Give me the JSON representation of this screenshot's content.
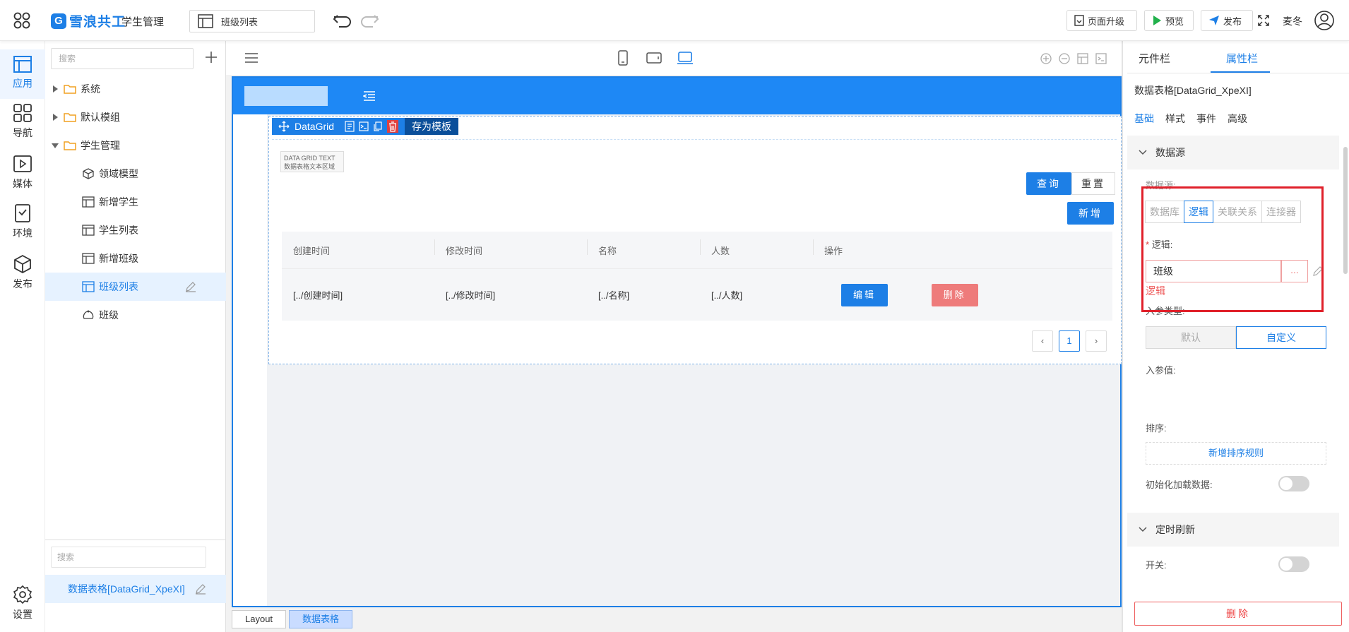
{
  "header": {
    "brand": "雪浪共工",
    "app_name": "学生管理",
    "page_selector": "班级列表",
    "buttons": {
      "upgrade": "页面升级",
      "preview": "预览",
      "publish": "发布"
    },
    "user": "麦冬"
  },
  "rail": [
    {
      "label": "应用",
      "active": true
    },
    {
      "label": "导航"
    },
    {
      "label": "媒体"
    },
    {
      "label": "环境"
    },
    {
      "label": "发布"
    },
    {
      "label": "设置"
    }
  ],
  "tree": {
    "search_placeholder": "搜索",
    "items": [
      {
        "label": "系统",
        "type": "folder"
      },
      {
        "label": "默认模组",
        "type": "folder"
      },
      {
        "label": "学生管理",
        "type": "folder",
        "expanded": true
      },
      {
        "label": "领域模型",
        "type": "model"
      },
      {
        "label": "新增学生",
        "type": "page"
      },
      {
        "label": "学生列表",
        "type": "page"
      },
      {
        "label": "新增班级",
        "type": "page"
      },
      {
        "label": "班级列表",
        "type": "page",
        "selected": true
      },
      {
        "label": "班级",
        "type": "logic"
      }
    ],
    "component_search_placeholder": "搜索",
    "component_selected": "数据表格[DataGrid_XpeXI]"
  },
  "canvas": {
    "datagrid_bar": {
      "name": "DataGrid",
      "save_template": "存为模板"
    },
    "datagrid_text_line1": "DATA GRID TEXT",
    "datagrid_text_line2": "数据表格文本区域",
    "query_button": "查询",
    "reset_button": "重置",
    "new_button": "新增",
    "columns": [
      "创建时间",
      "修改时间",
      "名称",
      "人数",
      "操作"
    ],
    "row": [
      "[../创建时间]",
      "[../修改时间]",
      "[../名称]",
      "[../人数]"
    ],
    "edit_button": "编辑",
    "delete_button": "删除",
    "page_current": "1",
    "breadcrumbs": [
      "Layout",
      "数据表格"
    ]
  },
  "props": {
    "tabs": [
      "元件栏",
      "属性栏"
    ],
    "active_tab": "属性栏",
    "title": "数据表格[DataGrid_XpeXI]",
    "subtabs": [
      "基础",
      "样式",
      "事件",
      "高级"
    ],
    "section_datasource": "数据源",
    "datasource_label": "数据源:",
    "datasource_options": [
      "数据库",
      "逻辑",
      "关联关系",
      "连接器"
    ],
    "datasource_selected": "逻辑",
    "logic_label": "逻辑:",
    "logic_value": "班级",
    "logic_dots": "...",
    "logic_error": "逻辑",
    "param_type_label": "入参类型:",
    "param_type_options": [
      "默认",
      "自定义"
    ],
    "param_value_label": "入参值:",
    "sort_label": "排序:",
    "add_sort_rule": "新增排序规则",
    "init_load_label": "初始化加载数据:",
    "section_timer": "定时刷新",
    "switch_label": "开关:",
    "delete_button": "删除"
  },
  "colors": {
    "primary": "#1d7fe6",
    "danger": "#ee7b7b",
    "highlight_box": "#e0202a"
  }
}
